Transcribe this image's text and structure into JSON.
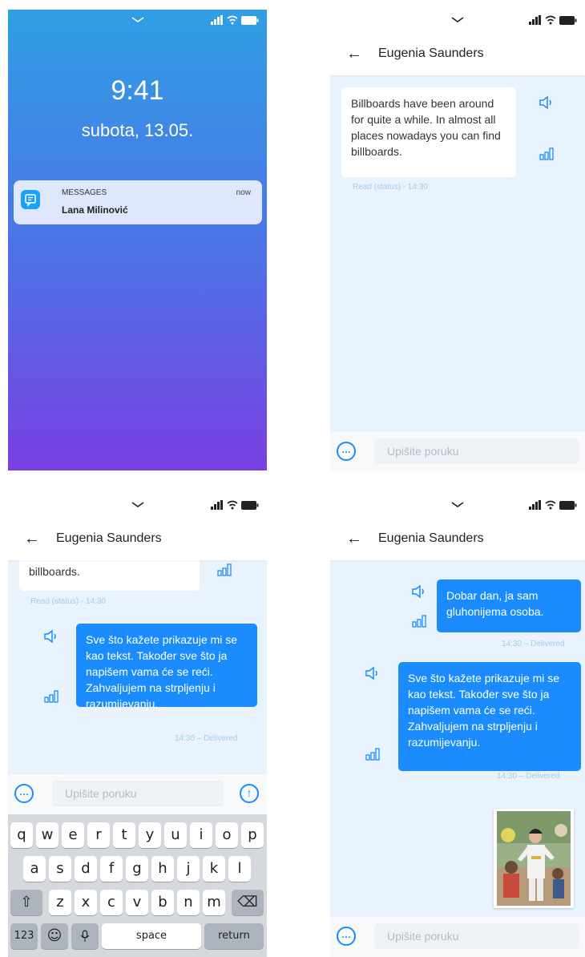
{
  "lock": {
    "time": "9:41",
    "date": "subota, 13.05.",
    "notification": {
      "app": "MESSAGES",
      "time": "now",
      "sender": "Lana Milinović"
    }
  },
  "chat": {
    "contact": "Eugenia Saunders",
    "input_placeholder": "Upišite poruku",
    "incoming_message": "Billboards have been around for quite a while. In almost all places nowadays you can find billboards.",
    "incoming_tail": "billboards.",
    "read_status": "Read (status) - 14:30",
    "outgoing_1": "Dobar dan, ja sam gluhonijema osoba.",
    "outgoing_2": "Sve što kažete prikazuje mi se kao tekst. Također sve što ja napišem vama će se reći. Zahvaljujem na strpljenju i razumijevanju.",
    "delivered": "14:30 – Delivered"
  },
  "keyboard": {
    "row1": [
      "q",
      "w",
      "e",
      "r",
      "t",
      "y",
      "u",
      "i",
      "o",
      "p"
    ],
    "row2": [
      "a",
      "s",
      "d",
      "f",
      "g",
      "h",
      "j",
      "k",
      "l"
    ],
    "row3": [
      "z",
      "x",
      "c",
      "v",
      "b",
      "n",
      "m"
    ],
    "numbers": "123",
    "space": "space",
    "return": "return"
  },
  "colors": {
    "accent": "#1a8cff",
    "chat_bg": "#e8f3fd",
    "lock_top": "#2f9fe3",
    "lock_bottom": "#7a3fe3"
  },
  "icons": [
    "chevron-down-icon",
    "signal-icon",
    "wifi-icon",
    "battery-icon",
    "messages-app-icon",
    "back-arrow-icon",
    "speaker-icon",
    "bars-icon",
    "more-icon",
    "send-icon",
    "shift-icon",
    "backspace-icon",
    "emoji-icon",
    "mic-icon"
  ]
}
